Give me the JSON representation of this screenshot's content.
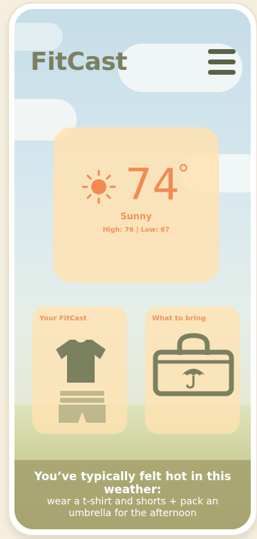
{
  "app": {
    "title": "FitCast"
  },
  "header": {
    "menu_icon": "hamburger-menu-icon"
  },
  "weather": {
    "icon": "sun-icon",
    "temperature": "74",
    "condition": "Sunny",
    "high_low": "High: 76 | Low: 67"
  },
  "cards": {
    "fitcast": {
      "title": "Your FitCast",
      "icons": [
        "t-shirt-icon",
        "shorts-icon"
      ]
    },
    "bring": {
      "title": "What to bring",
      "icons": [
        "bag-icon",
        "umbrella-icon"
      ]
    }
  },
  "banner": {
    "headline": "You’ve typically felt hot in this weather:",
    "detail": "wear a t-shirt and shorts + pack an umbrella for the afternoon"
  },
  "colors": {
    "accent_orange": "#f28a52",
    "card_bg": "#ffe2b2",
    "olive": "#7b805f",
    "banner_bg": "#a5a26e"
  }
}
